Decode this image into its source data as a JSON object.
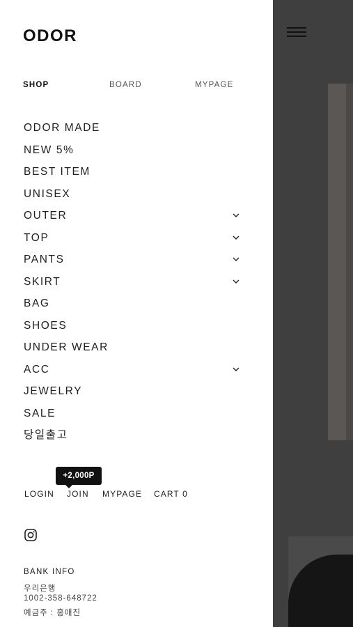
{
  "brand": {
    "logo": "ODOR"
  },
  "tabs": [
    {
      "label": "SHOP",
      "active": true
    },
    {
      "label": "BOARD",
      "active": false
    },
    {
      "label": "MYPAGE",
      "active": false
    }
  ],
  "menu": [
    {
      "label": "ODOR MADE",
      "expandable": false
    },
    {
      "label": "NEW 5%",
      "expandable": false
    },
    {
      "label": "BEST ITEM",
      "expandable": false
    },
    {
      "label": "UNISEX",
      "expandable": false
    },
    {
      "label": "OUTER",
      "expandable": true
    },
    {
      "label": "TOP",
      "expandable": true
    },
    {
      "label": "PANTS",
      "expandable": true
    },
    {
      "label": "SKIRT",
      "expandable": true
    },
    {
      "label": "BAG",
      "expandable": false
    },
    {
      "label": "SHOES",
      "expandable": false
    },
    {
      "label": "UNDER WEAR",
      "expandable": false
    },
    {
      "label": "ACC",
      "expandable": true
    },
    {
      "label": "JEWELRY",
      "expandable": false
    },
    {
      "label": "SALE",
      "expandable": false
    },
    {
      "label": "당일출고",
      "expandable": false
    }
  ],
  "member": {
    "point_badge": "+2,000P",
    "login": "LOGIN",
    "join": "JOIN",
    "mypage": "MYPAGE",
    "cart": "CART 0"
  },
  "social": {
    "icon": "instagram-icon"
  },
  "bank": {
    "title": "BANK INFO",
    "bank_name": "우리은행",
    "account": "1002-358-648722",
    "holder": "예금주 : 홍애진"
  },
  "colors": {
    "overlay": "#3f3f3f",
    "badge": "#111111"
  }
}
